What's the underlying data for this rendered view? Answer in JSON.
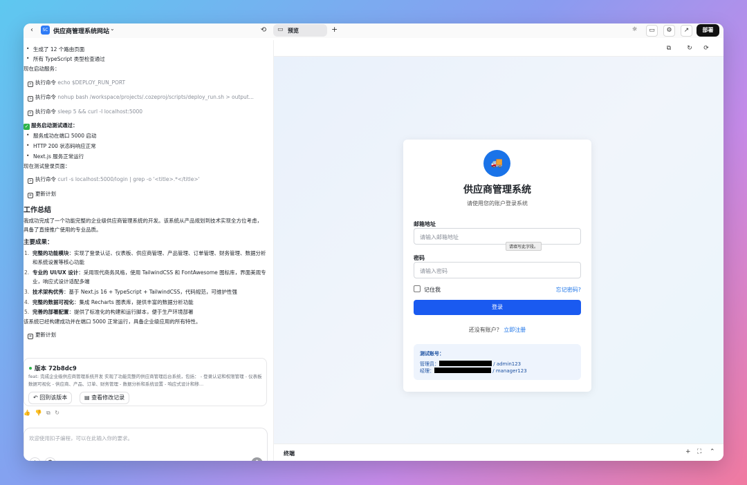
{
  "topbar": {
    "back_icon": "‹",
    "app_logo_text": "SC",
    "app_title": "供应商管理系统网站",
    "chevron": "⌄",
    "history_icon": "⟲",
    "tab_preview_icon": "▭",
    "tab_preview_label": "预览",
    "tab_add": "+",
    "sun_icon": "☼",
    "folder_icon": "▭",
    "settings_icon": "⚙",
    "external_icon": "↗",
    "deploy_label": "部署"
  },
  "chat": {
    "bullets_top": [
      "生成了 12 个路由页面",
      "所有 TypeScript 类型检查通过"
    ],
    "start_service": "现在启动服务：",
    "cmd_prefix": "执行命令",
    "cmds1": [
      "echo $DEPLOY_RUN_PORT",
      "nohup bash /workspace/projects/.cozeproj/scripts/deploy_run.sh > output...",
      "sleep 5 && curl -I localhost:5000"
    ],
    "test_pass": "服务启动测试通过：",
    "bullets_mid": [
      "服务成功在端口 5000 启动",
      "HTTP 200 状态码响应正常",
      "Next.js 服务正常运行"
    ],
    "test_login": "现在测试登录页面：",
    "cmd2": "curl -s localhost:5000/login | grep -o '<title>.*</title>'",
    "update_plan": "更新计划",
    "summary_title": "工作总结",
    "summary_para": "我成功完成了一个功能完整的企业级供应商管理系统的开发。该系统从产品规划到技术实现全方位考虑，具备了直接推广使用的专业品质。",
    "results_title": "主要成果：",
    "results": [
      {
        "num": "1.",
        "bold": "完整的功能模块",
        "text": "：实现了登录认证、仪表板、供应商管理、产品管理、订单管理、财务管理、数据分析和系统设置等核心功能"
      },
      {
        "num": "2.",
        "bold": "专业的 UI/UX 设计",
        "text": "：采用现代商务风格，使用 TailwindCSS 和 FontAwesome 图标库，界面美观专业，响应式设计适配多端"
      },
      {
        "num": "3.",
        "bold": "技术架构优秀",
        "text": "：基于 Next.js 16 + TypeScript + TailwindCSS，代码规范，可维护性强"
      },
      {
        "num": "4.",
        "bold": "完整的数据可视化",
        "text": "：集成 Recharts 图表库，提供丰富的数据分析功能"
      },
      {
        "num": "5.",
        "bold": "完善的部署配置",
        "text": "：提供了标准化的构建和运行脚本，便于生产环境部署"
      }
    ],
    "closing": "该系统已经构建成功并在端口 5000 正常运行，具备企业级应用的所有特性。",
    "update_plan2": "更新计划",
    "version": {
      "title": "版本 72b8dc9",
      "desc": "feat: 完成企业级供应商管理系统开发 实现了功能完整的供应商管理后台系统，包括： - 登录认证和权限管理 - 仪表板数据可视化 - 供应商、产品、订单、财务管理 - 数据分析和系统设置 - 响应式设计和移...",
      "rollback_label": "回到该版本",
      "changes_label": "查看修改记录"
    },
    "reactions": [
      "👍",
      "👎",
      "⧉",
      "↻"
    ],
    "input_placeholder": "欢迎使用扣子编程，可以在此输入你的要求。",
    "input_add": "+",
    "input_settings": "⚙",
    "send_icon": "↑"
  },
  "preview": {
    "tool_icons": [
      "⧉",
      "↻",
      "⟳"
    ],
    "terminal_label": "终端",
    "terminal_icons": [
      "+",
      "⛶",
      "⌃"
    ]
  },
  "login": {
    "logo_icon": "🚚",
    "title": "供应商管理系统",
    "subtitle": "请使用您的账户登录系统",
    "email_label": "邮箱地址",
    "email_placeholder": "请输入邮箱地址",
    "tooltip": "请填写此字段。",
    "password_label": "密码",
    "password_placeholder": "请输入密码",
    "remember_label": "记住我",
    "forgot_label": "忘记密码?",
    "login_button": "登录",
    "no_account": "还没有账户？",
    "register_link": "立即注册",
    "test_title": "测试账号：",
    "test_admin_prefix": "管理员：",
    "test_admin_pass": "/ admin123",
    "test_manager_prefix": "经理：",
    "test_manager_pass": "/ manager123"
  }
}
